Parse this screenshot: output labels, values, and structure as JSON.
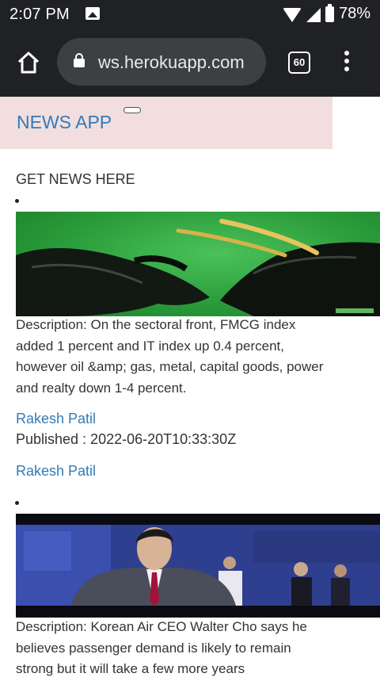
{
  "status_bar": {
    "time": "2:07 PM",
    "battery": "78%"
  },
  "browser": {
    "url": "ws.herokuapp.com",
    "tab_count": "60"
  },
  "navbar": {
    "brand": "NEWS APP"
  },
  "main": {
    "heading": "GET NEWS HERE",
    "articles": [
      {
        "description": "Description: On the sectoral front, FMCG index added 1 percent and IT index up 0.4 percent, however oil &amp; gas, metal, capital goods, power and realty down 1-4 percent.",
        "author": "Rakesh Patil",
        "published": "Published : 2022-06-20T10:33:30Z",
        "author_link": "Rakesh Patil"
      },
      {
        "description": "Description: Korean Air CEO Walter Cho says he believes passenger demand is likely to remain strong but it will take a few more years"
      }
    ]
  },
  "colors": {
    "status_bar_bg": "#202124",
    "navbar_bg": "#f2dede",
    "link": "#337ab7"
  },
  "icons": [
    "image-notification-icon",
    "wifi-icon",
    "cell-signal-icon",
    "battery-icon",
    "home-icon",
    "lock-icon",
    "tab-switcher-icon",
    "overflow-menu-icon"
  ]
}
